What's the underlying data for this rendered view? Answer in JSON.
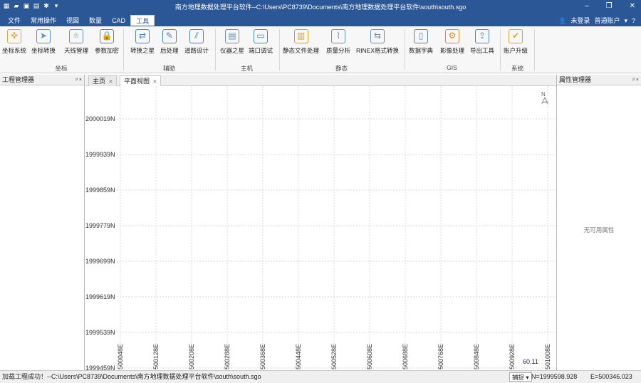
{
  "titlebar": {
    "title": "南方地理数据处理平台软件--C:\\Users\\PC8739\\Documents\\南方地理数据处理平台软件\\south\\south.sgo",
    "qat_icons": [
      "app-icon",
      "open-icon",
      "save-icon",
      "save-as-icon",
      "settings-icon",
      "dropdown-icon"
    ],
    "ctrl_minimize": "–",
    "ctrl_restore": "❐",
    "ctrl_close": "✕"
  },
  "menu": {
    "items": [
      "文件",
      "常用操作",
      "视図",
      "数量",
      "CAD",
      "工具"
    ],
    "active": "工具"
  },
  "account": {
    "user_icon": "👤",
    "login": "未登录",
    "user_type": "普通账户",
    "dropdown": "▾",
    "help": "?"
  },
  "ribbon": {
    "groups": [
      {
        "label": "坐标",
        "buttons": [
          "坐标系统",
          "坐标转换",
          "天线管理",
          "参数加密"
        ]
      },
      {
        "label": "辅助",
        "buttons": [
          "转换之星",
          "后处理",
          "道路设计"
        ]
      },
      {
        "label": "主机",
        "buttons": [
          "仪器之星",
          "端口调试"
        ]
      },
      {
        "label": "静态",
        "buttons": [
          "静态文件处理",
          "质量分析",
          "RINEX格式转换"
        ]
      },
      {
        "label": "GIS",
        "buttons": [
          "数据字典",
          "影像处理",
          "导出工具"
        ]
      },
      {
        "label": "系统",
        "buttons": [
          "账户升级"
        ]
      }
    ]
  },
  "left_panel": {
    "title": "工程管理器",
    "pin": "ᵖ ×"
  },
  "right_panel": {
    "title": "属性管理器",
    "pin": "ᵖ ×",
    "empty_text": "无可用属性"
  },
  "doc_tabs": [
    {
      "label": "主页",
      "close": "✕"
    },
    {
      "label": "平面视图",
      "close": "✕"
    }
  ],
  "plan_view": {
    "y_labels": [
      "2000019N",
      "1999939N",
      "1999859N",
      "1999779N",
      "1999699N",
      "1999619N",
      "1999539N",
      "1999459N"
    ],
    "x_labels": [
      "500048E",
      "500128E",
      "500208E",
      "500288E",
      "500368E",
      "500448E",
      "500528E",
      "500608E",
      "500688E",
      "500768E",
      "500848E",
      "500928E",
      "501008E"
    ],
    "scale_text": "60.11",
    "north_marker": "N",
    "grid_color": "#d8d8d8"
  },
  "status": {
    "message": "加载工程成功！--C:\\Users\\PC8739\\Documents\\南方地理数据处理平台软件\\south\\south.sgo",
    "snap": "捕捉 ▾",
    "n_coord": "N=1999598.928",
    "e_coord": "E=500346.023"
  }
}
